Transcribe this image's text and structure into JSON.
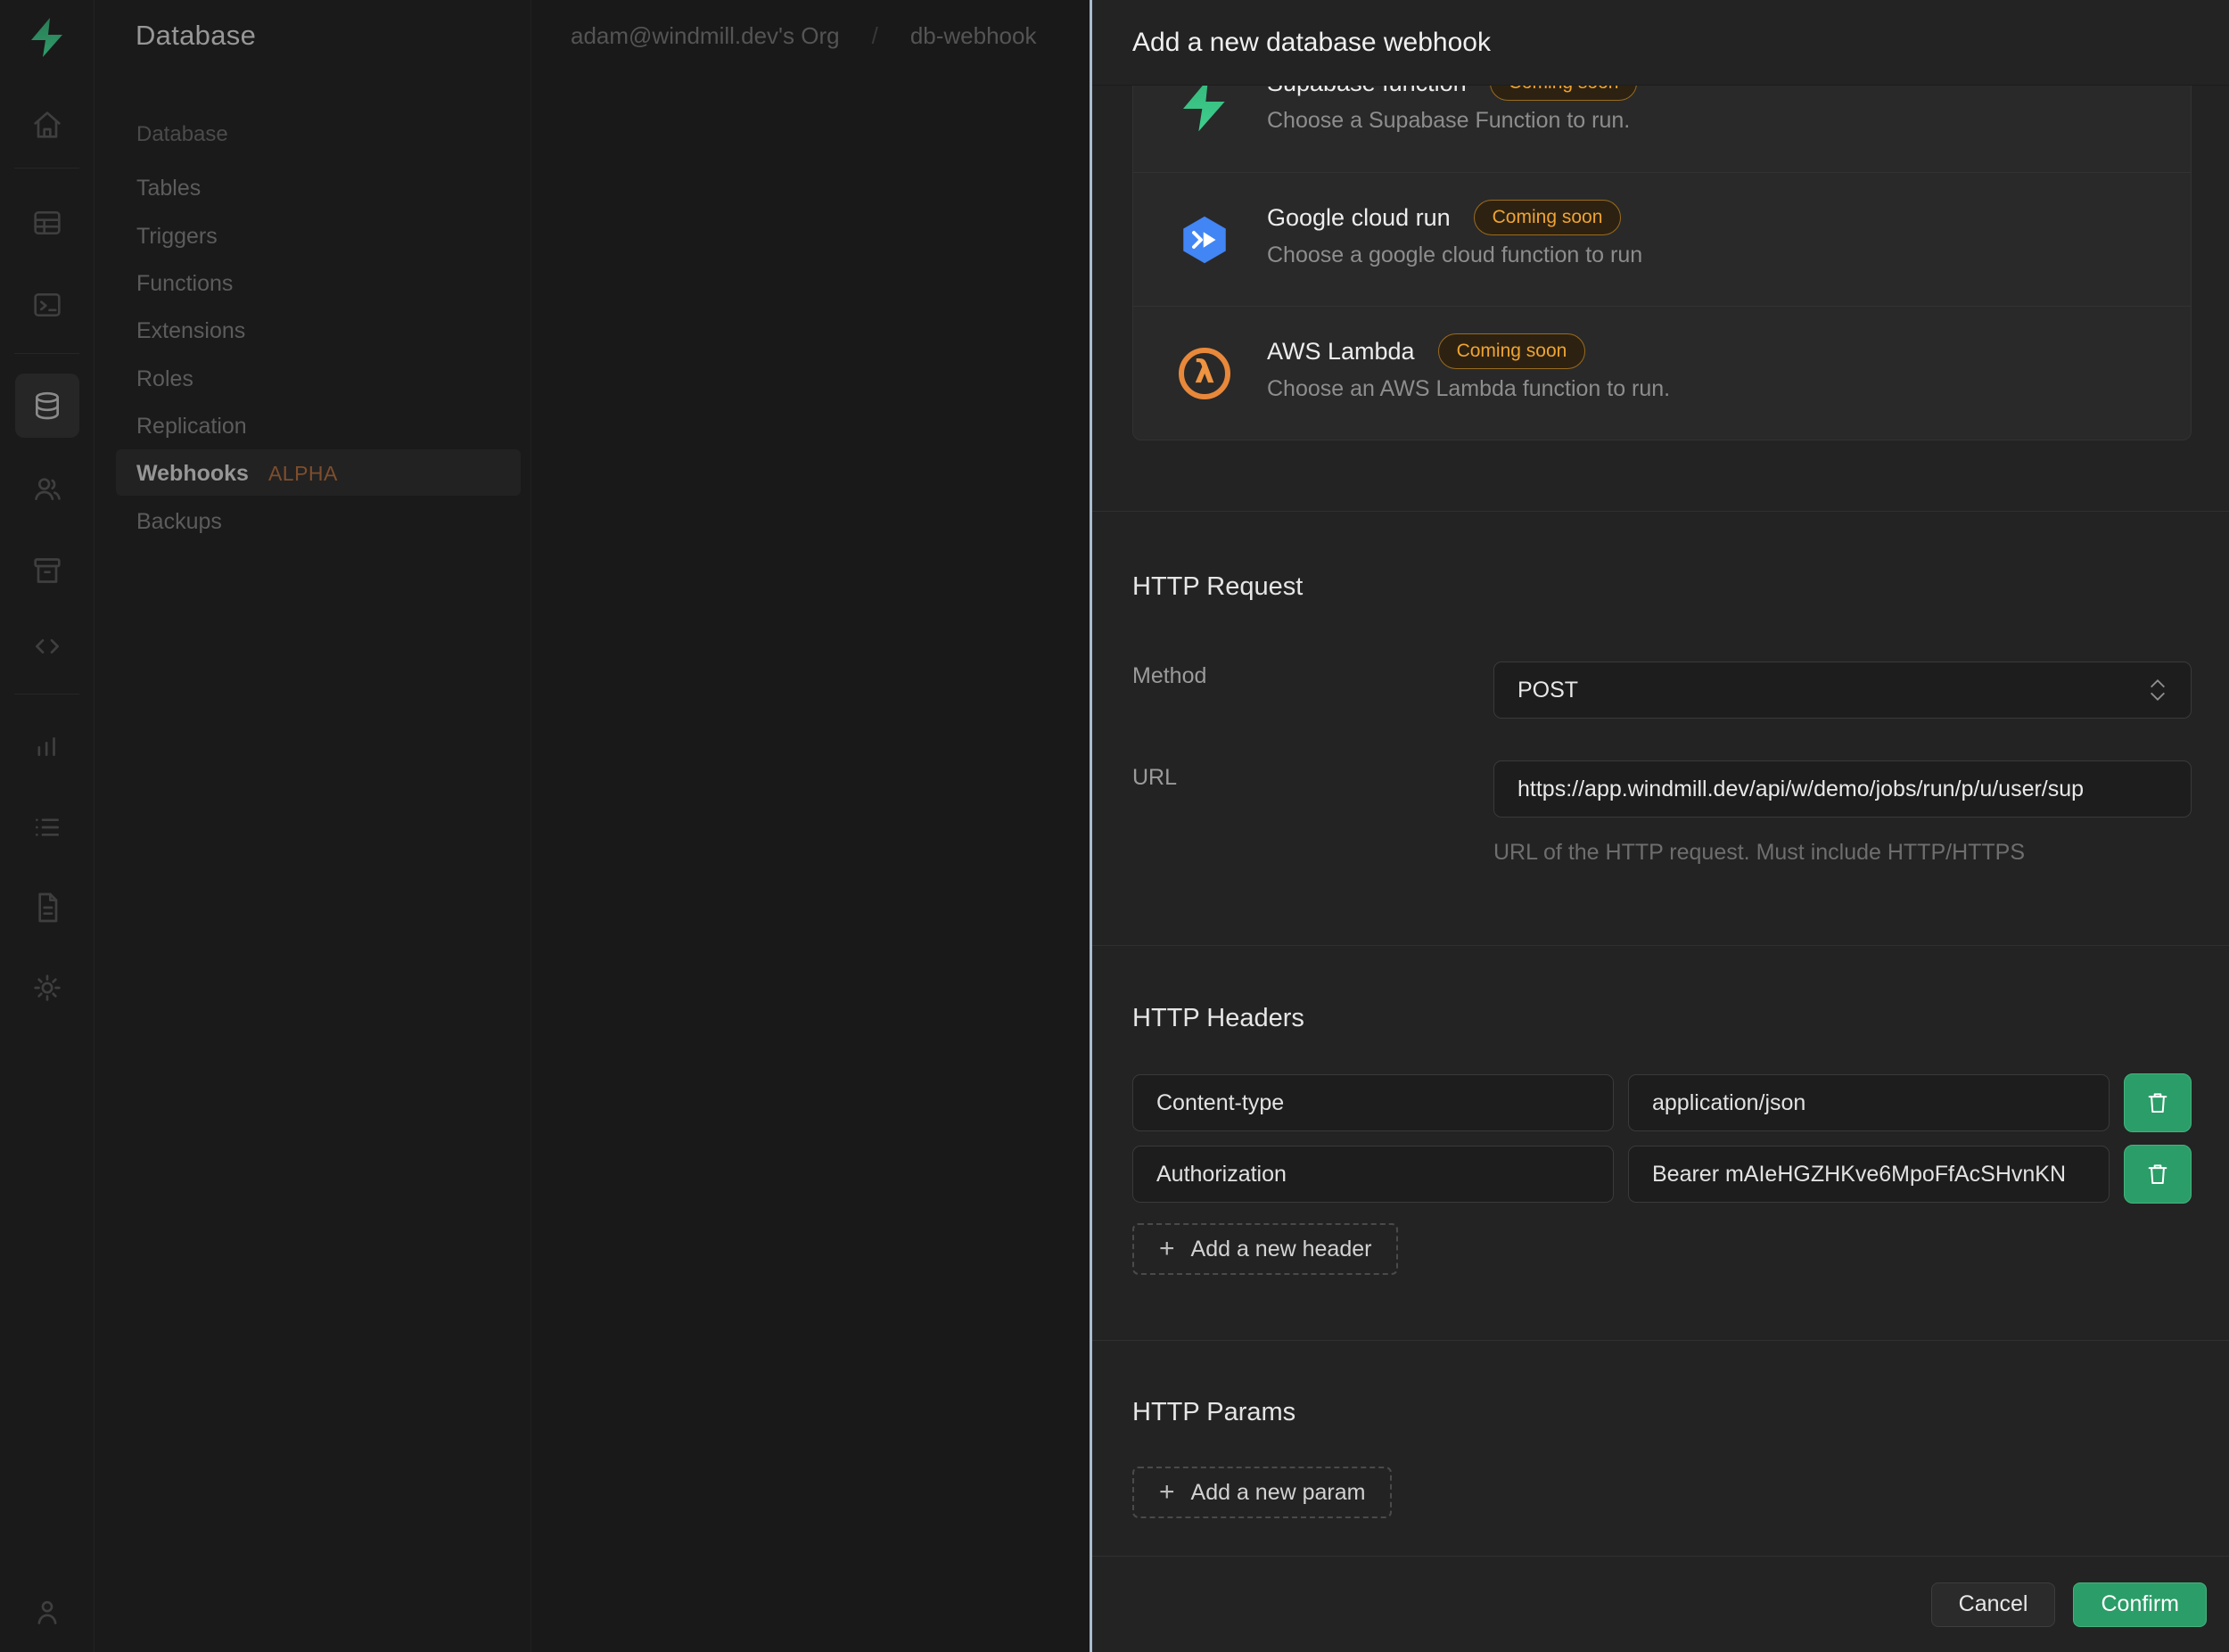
{
  "colors": {
    "brand_green": "#3ECF8E",
    "button_green": "#2b9d68",
    "badge_amber": "#f0a431",
    "panel_bg": "#232323",
    "page_bg": "#1a1a1a",
    "focus_divider": "#a9bccf"
  },
  "icons": {
    "lambda_glyph": "λ",
    "plus_glyph": "+"
  },
  "nav": {
    "title": "Database",
    "section": "Database",
    "items": [
      {
        "label": "Tables"
      },
      {
        "label": "Triggers"
      },
      {
        "label": "Functions"
      },
      {
        "label": "Extensions"
      },
      {
        "label": "Roles"
      },
      {
        "label": "Replication"
      },
      {
        "label": "Webhooks",
        "badge": "ALPHA",
        "active": true
      },
      {
        "label": "Backups"
      }
    ]
  },
  "topbar": {
    "breadcrumb": {
      "org": "adam@windmill.dev's Org",
      "separator": "/",
      "project": "db-webhook"
    }
  },
  "panel": {
    "title": "Add a new database webhook",
    "options": [
      {
        "title": "Supabase function",
        "badge": "Coming soon",
        "description": "Choose a Supabase Function to run.",
        "icon": "supabase-bolt"
      },
      {
        "title": "Google cloud run",
        "badge": "Coming soon",
        "description": "Choose a google cloud function to run",
        "icon": "google-cloud-run"
      },
      {
        "title": "AWS Lambda",
        "badge": "Coming soon",
        "description": "Choose an AWS Lambda function to run.",
        "icon": "aws-lambda"
      }
    ],
    "http_request": {
      "title": "HTTP Request",
      "method_label": "Method",
      "method_value": "POST",
      "url_label": "URL",
      "url_value": "https://app.windmill.dev/api/w/demo/jobs/run/p/u/user/sup",
      "url_help": "URL of the HTTP request. Must include HTTP/HTTPS"
    },
    "http_headers": {
      "title": "HTTP Headers",
      "rows": [
        {
          "key": "Content-type",
          "value": "application/json"
        },
        {
          "key": "Authorization",
          "value": "Bearer mAIeHGZHKve6MpoFfAcSHvnKN"
        }
      ],
      "add_label": "Add a new header"
    },
    "http_params": {
      "title": "HTTP Params",
      "add_label": "Add a new param"
    },
    "footer": {
      "cancel": "Cancel",
      "confirm": "Confirm"
    }
  }
}
